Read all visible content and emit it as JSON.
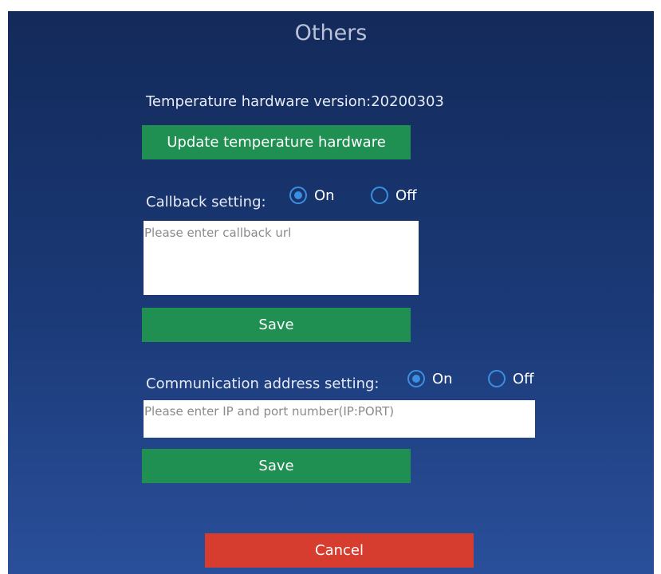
{
  "page": {
    "title": "Others"
  },
  "temperature": {
    "version_label": "Temperature hardware version:20200303",
    "update_button": "Update temperature hardware"
  },
  "callback": {
    "label": "Callback setting:",
    "on_label": "On",
    "off_label": "Off",
    "selected": "On",
    "url_placeholder": "Please enter callback url",
    "url_value": "",
    "save_button": "Save"
  },
  "communication": {
    "label": "Communication address setting:",
    "on_label": "On",
    "off_label": "Off",
    "selected": "On",
    "address_placeholder": "Please enter IP and port number(IP:PORT)",
    "address_value": "",
    "save_button": "Save"
  },
  "footer": {
    "cancel_button": "Cancel"
  },
  "colors": {
    "panel_top": "#132a5a",
    "panel_bottom": "#2a4f9a",
    "primary_button": "#1f8f52",
    "cancel_button": "#d63d2f",
    "radio_accent": "#3b8fe0"
  }
}
